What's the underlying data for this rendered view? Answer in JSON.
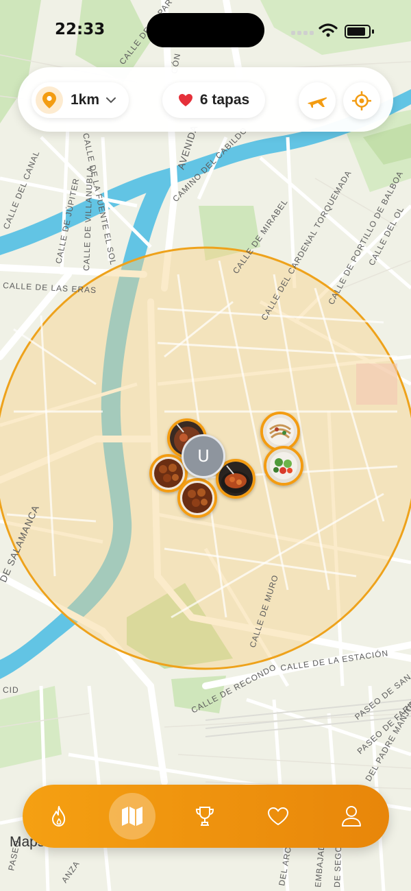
{
  "status_bar": {
    "time": "22:33"
  },
  "top_bar": {
    "radius_value": "1km",
    "favorites_label": "6 tapas"
  },
  "map": {
    "streets": [
      "CALLE DE LA PARVA DE LA REINA",
      "GÓN",
      "AVENIDA",
      "CAMINO DEL CABILDO",
      "CALLE DE LA FUENTE EL SOL",
      "CALLE DE JÚPITER",
      "CALLE DE VILLANUBLA",
      "CALLE DEL CANAL",
      "CALLE DE MIRABEL",
      "CALLE DEL CARDENAL TORQUEMADA",
      "CALLE DE PORTILLO DE BALBOA",
      "CALLE DEL OL",
      "CALLE DE LAS ERAS",
      "DE SALAMANCA",
      "CALLE DE MURO",
      "CALLE DE LA ESTACIÓN",
      "CALLE DE RECONDO",
      "PASEO DE SAN VIC",
      "PASEO DE FARNESIO",
      "DEL PADRE MANJÓN",
      "PASEO",
      "CID",
      "ANZA",
      "EMBAJADORES",
      "DEL ARCA R",
      "DE SEGOVIA"
    ],
    "attribution": "Maps"
  },
  "user_marker": {
    "initial": "U"
  },
  "tapas_markers": [
    {
      "name": "tapa-1",
      "dish": "octopus"
    },
    {
      "name": "tapa-2",
      "dish": "meatballs"
    },
    {
      "name": "tapa-3",
      "dish": "meatballs"
    },
    {
      "name": "tapa-4",
      "dish": "stew"
    },
    {
      "name": "tapa-5",
      "dish": "noodles"
    },
    {
      "name": "tapa-6",
      "dish": "salad"
    }
  ],
  "nav": {
    "tabs": [
      {
        "id": "trending",
        "icon": "flame-icon",
        "active": false
      },
      {
        "id": "map",
        "icon": "map-icon",
        "active": true
      },
      {
        "id": "ranking",
        "icon": "trophy-icon",
        "active": false
      },
      {
        "id": "favorites",
        "icon": "heart-icon",
        "active": false
      },
      {
        "id": "profile",
        "icon": "user-icon",
        "active": false
      }
    ]
  },
  "colors": {
    "accent": "#f39c12",
    "river": "#5bc0e0",
    "park": "#c5e3b0",
    "radius_fill": "#f9dfa8"
  }
}
